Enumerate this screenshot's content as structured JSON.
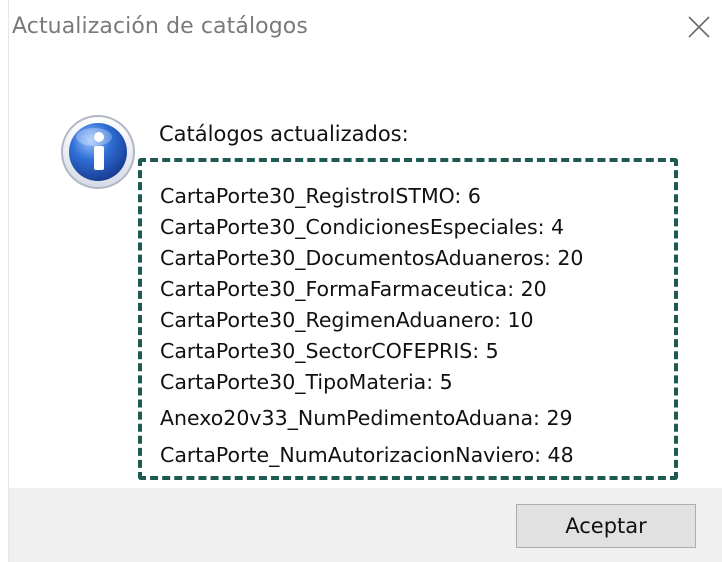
{
  "window": {
    "title": "Actualización de catálogos",
    "close_icon": "close-icon"
  },
  "message": {
    "icon": "info-icon",
    "heading": "Catálogos actualizados:",
    "items": [
      "CartaPorte30_RegistroISTMO: 6",
      "CartaPorte30_CondicionesEspeciales: 4",
      "CartaPorte30_DocumentosAduaneros: 20",
      "CartaPorte30_FormaFarmaceutica: 20",
      "CartaPorte30_RegimenAduanero: 10",
      "CartaPorte30_SectorCOFEPRIS: 5",
      "CartaPorte30_TipoMateria: 5",
      "Anexo20v33_NumPedimentoAduana: 29",
      "CartaPorte_NumAutorizacionNaviero: 48"
    ]
  },
  "footer": {
    "ok_label": "Aceptar"
  },
  "colors": {
    "highlight_border": "#1f5a52",
    "footer_background": "#f0f0f0",
    "icon_blue": "#2a63c6"
  }
}
